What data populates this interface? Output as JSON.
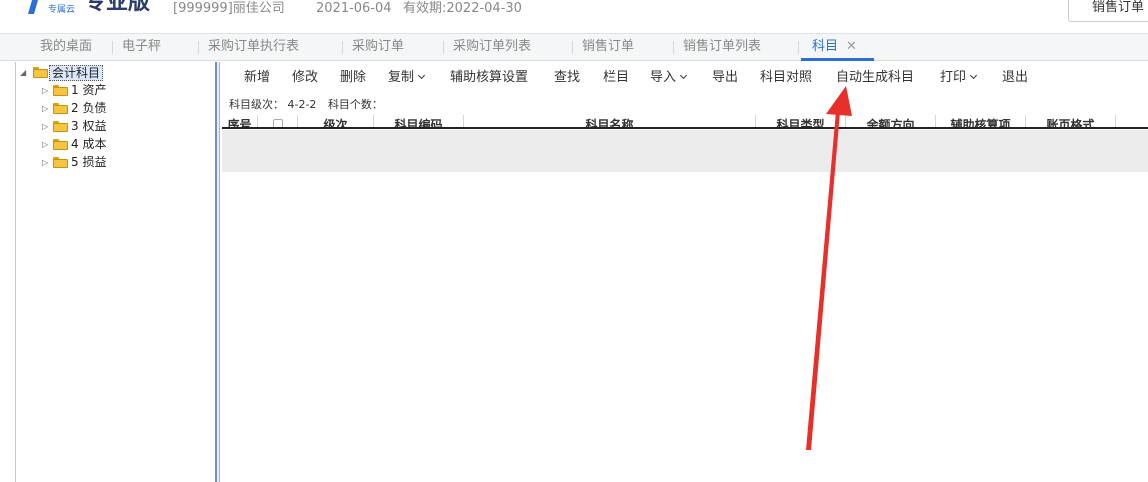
{
  "header": {
    "logo_sub": "专属云",
    "logo_title": "专业版",
    "company": "[999999]丽佳公司",
    "date": "2021-06-04",
    "validity": "有效期:2022-04-30",
    "right_button": "销售订单"
  },
  "tabs": [
    {
      "label": "我的桌面"
    },
    {
      "label": "电子秤"
    },
    {
      "label": "采购订单执行表"
    },
    {
      "label": "采购订单"
    },
    {
      "label": "采购订单列表"
    },
    {
      "label": "销售订单"
    },
    {
      "label": "销售订单列表"
    },
    {
      "label": "科目",
      "active": true,
      "close": "✕"
    }
  ],
  "tree": {
    "root": "会计科目",
    "children": [
      "1 资产",
      "2 负债",
      "3 权益",
      "4 成本",
      "5 损益"
    ]
  },
  "toolbar": {
    "items": [
      {
        "label": "新增"
      },
      {
        "label": "修改"
      },
      {
        "label": "删除"
      },
      {
        "label": "复制",
        "dropdown": true
      },
      {
        "label": "辅助核算设置"
      },
      {
        "label": "查找"
      },
      {
        "label": "栏目"
      },
      {
        "label": "导入",
        "dropdown": true
      },
      {
        "label": "导出"
      },
      {
        "label": "科目对照"
      },
      {
        "label": "自动生成科目"
      },
      {
        "label": "打印",
        "dropdown": true
      },
      {
        "label": "退出"
      }
    ]
  },
  "level_bar": {
    "level_label": "科目级次：",
    "level_value": "4-2-2",
    "count_label": "科目个数："
  },
  "grid": {
    "columns": [
      "序号",
      "",
      "级次",
      "科目编码",
      "科目名称",
      "科目类型",
      "余额方向",
      "辅助核算项",
      "账页格式"
    ]
  },
  "colors": {
    "accent": "#2a6fd6",
    "annotation_arrow": "#e8302a"
  }
}
